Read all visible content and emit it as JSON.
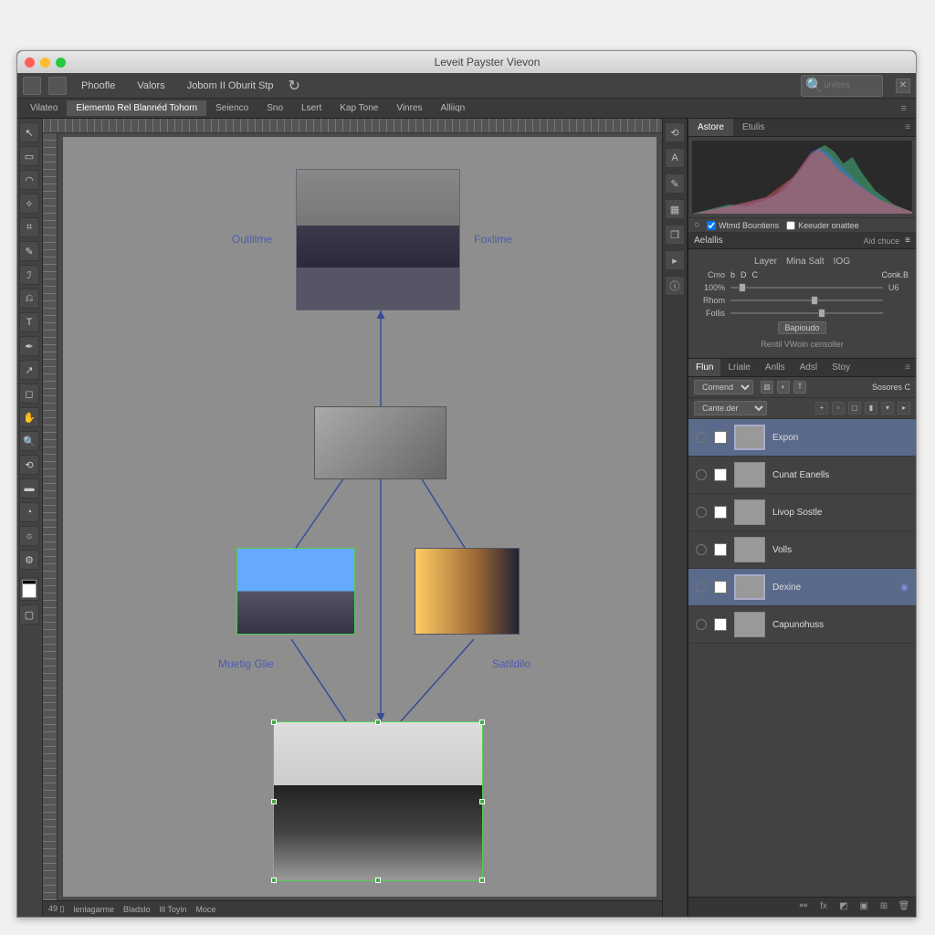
{
  "window": {
    "title": "Leveit Payster Vievon"
  },
  "optionbar": {
    "btn1": "Phoofle",
    "btn2": "Valors",
    "btn3": "Jobom II Oburit Stp",
    "search_placeholder": "unlites"
  },
  "menubar": {
    "tabs": [
      "Vilateo",
      "Elemento Rel Blannéd Tohorn",
      "Seienco",
      "Sno",
      "Lsert",
      "Kap Tone",
      "Vinres",
      "Alliiqn"
    ]
  },
  "canvas": {
    "labels": {
      "outline": "Outlilme",
      "foxime": "Foxlime",
      "muetig": "Muetig Glie",
      "satido": "Satildilo"
    }
  },
  "statusbar": {
    "zoom": "49 ▯",
    "a": "lenlagarme",
    "b": "Bladslo",
    "c": "Ill Toyin",
    "d": "Moce"
  },
  "histpanel": {
    "tabs": [
      "Astore",
      "Etulis"
    ],
    "opt1": "Wtmd Bountiens",
    "opt2": "Keeuder onattee"
  },
  "adjust": {
    "head": "Aelallis",
    "dd": "Aid chuce",
    "subtabs": [
      "Layer",
      "Mina Salt",
      "IOG"
    ],
    "row1": {
      "lbl": "Cmo",
      "a": "b",
      "b": "D",
      "c": "C",
      "d": "Conk.B"
    },
    "row2": {
      "lbl": "100%",
      "end": "U6"
    },
    "row3": {
      "lbl": "Rhom"
    },
    "row4": {
      "lbl": "Follis"
    },
    "btn": "Bapioudo",
    "foot": "Rentil  VWoln  censoller"
  },
  "layerpanel": {
    "tabs": [
      "Flun",
      "Lriale",
      "Anlls",
      "Adsl",
      "Stoy"
    ],
    "blend": "Comend",
    "search": "Sosores  C",
    "mode": "Cante.der",
    "layers": [
      {
        "name": "Expon",
        "selected": true,
        "thumb_cls": "th-a"
      },
      {
        "name": "Cunat Eanells",
        "thumb_cls": "th-b"
      },
      {
        "name": "Livop Sostle",
        "thumb_cls": "th-c"
      },
      {
        "name": "Volls",
        "thumb_cls": "th-d"
      },
      {
        "name": "Dexine",
        "selected": true,
        "fx": true,
        "thumb_cls": "th-e"
      },
      {
        "name": "Capunohuss",
        "thumb_cls": "th-f"
      }
    ]
  }
}
